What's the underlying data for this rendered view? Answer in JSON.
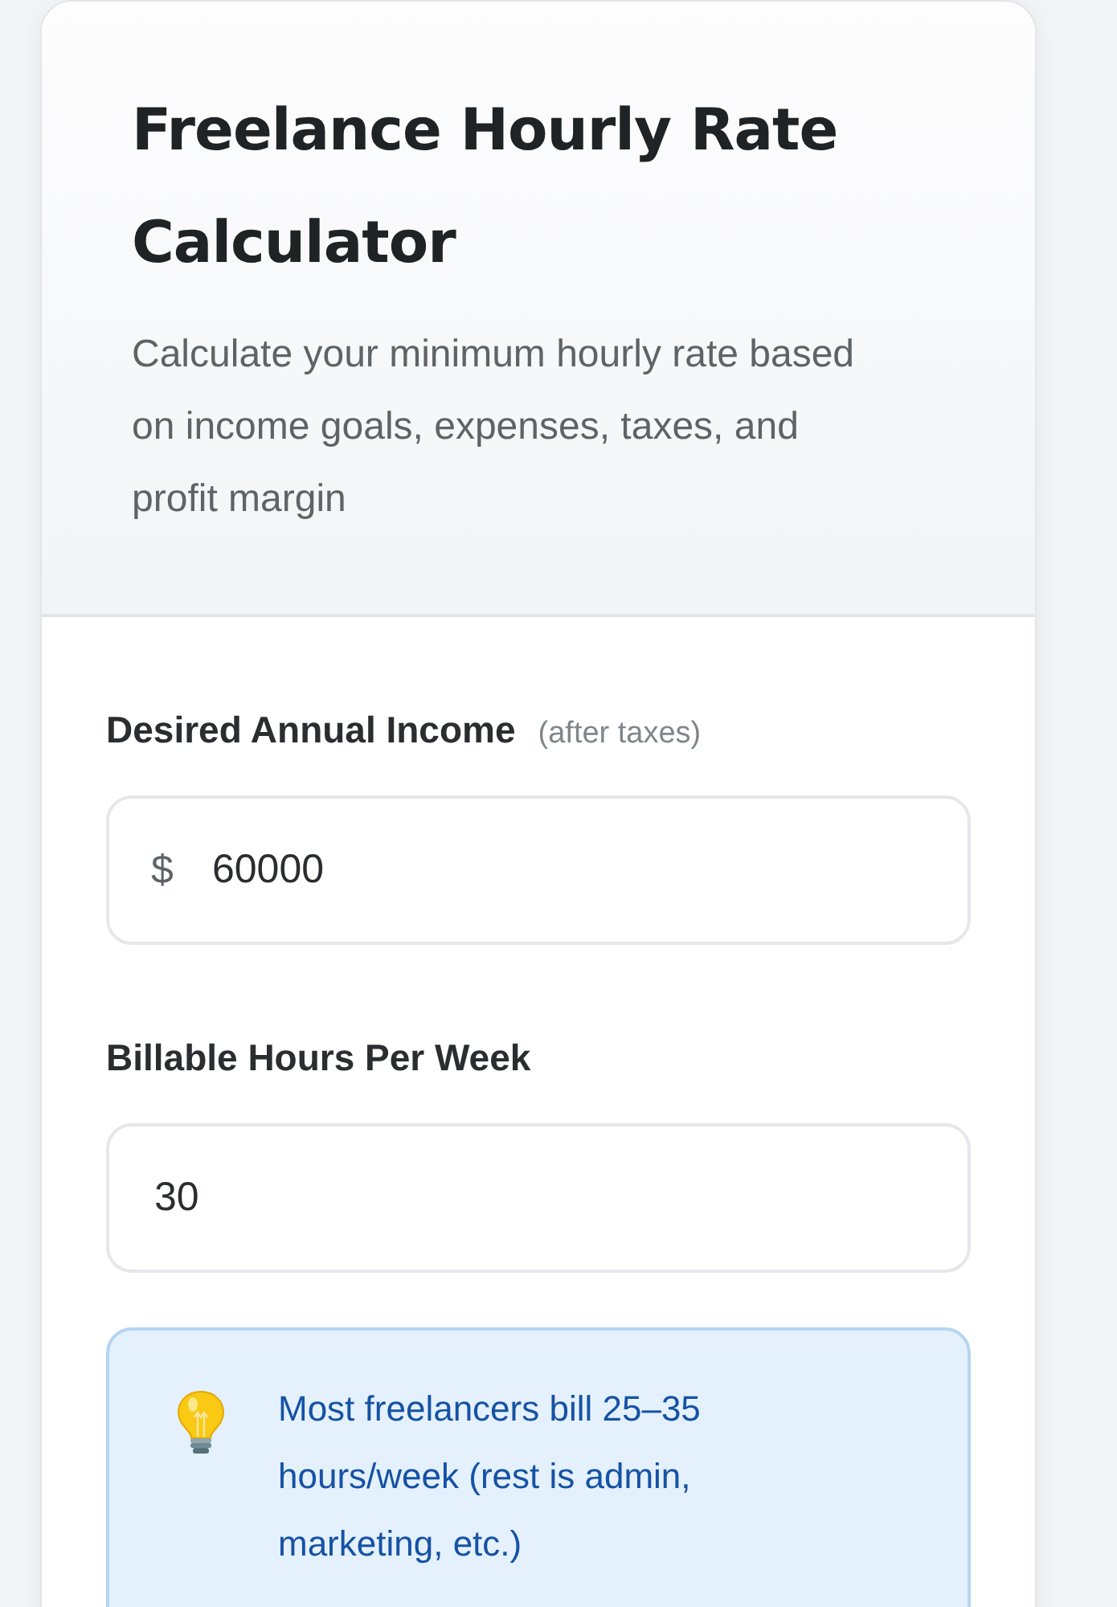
{
  "header": {
    "title": "Freelance Hourly Rate Calculator",
    "subtitle": "Calculate your minimum hourly rate based on income goals, expenses, taxes, and profit margin"
  },
  "fields": [
    {
      "label": "Desired Annual Income",
      "hint": "(after taxes)",
      "prefix": "$",
      "value": "60000"
    },
    {
      "label": "Billable Hours Per Week",
      "value": "30"
    }
  ],
  "tip": {
    "text": "Most freelancers bill 25–35 hours/week (rest is admin, marketing, etc.)"
  }
}
